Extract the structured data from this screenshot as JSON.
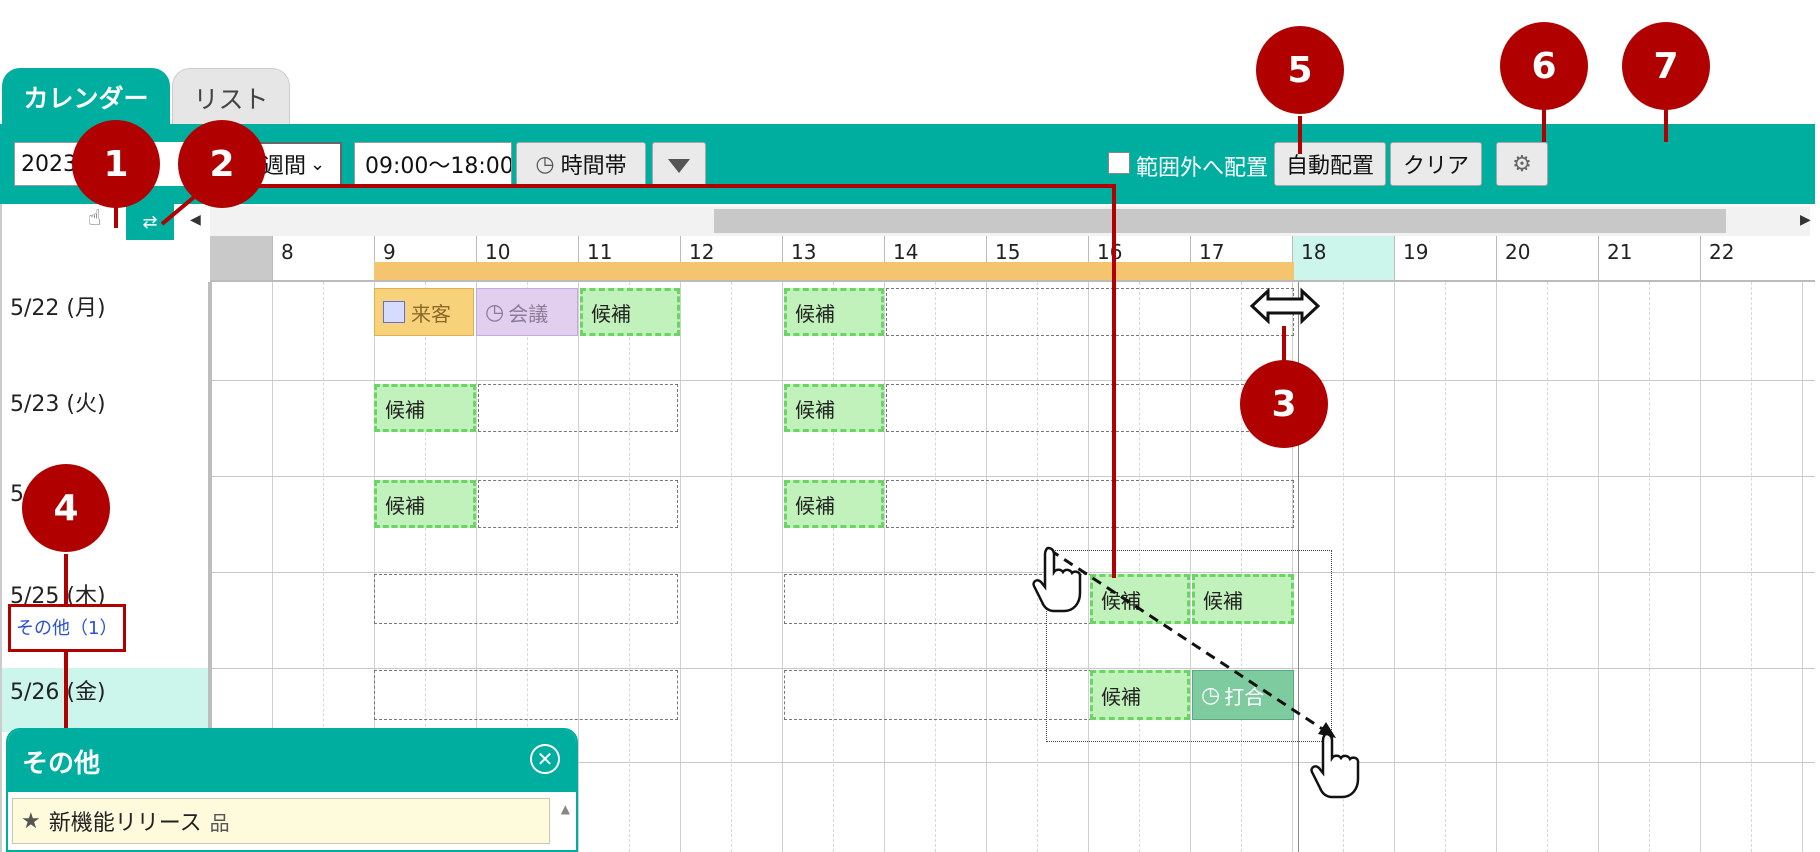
{
  "tabs": {
    "calendar": "カレンダー",
    "list": "リスト"
  },
  "toolbar": {
    "date_value": "2023",
    "period_value": "1週間",
    "time_range": "09:00～18:00",
    "timeband_label": "時間帯",
    "out_of_range_label": "範囲外へ配置",
    "auto_place_label": "自動配置",
    "clear_label": "クリア"
  },
  "hours": [
    "8",
    "9",
    "10",
    "11",
    "12",
    "13",
    "14",
    "15",
    "16",
    "17",
    "18",
    "19",
    "20",
    "21",
    "22"
  ],
  "rows": [
    {
      "label": "5/22 (月)"
    },
    {
      "label": "5/23 (火)"
    },
    {
      "label": "5/24 (水)",
      "visible_label": "5"
    },
    {
      "label": "5/25 (木)",
      "other_link": "その他（1）"
    },
    {
      "label": "5/26 (金)"
    }
  ],
  "events": {
    "raikyaku": "来客",
    "kaigi": "会議",
    "candidate": "候補",
    "uchiawase": "打合"
  },
  "markers": [
    "1",
    "2",
    "3",
    "4",
    "5",
    "6",
    "7"
  ],
  "popup": {
    "title": "その他",
    "item_label": "新機能リリース"
  },
  "colors": {
    "accent": "#00aea0",
    "marker": "#b00000",
    "candidate_fill": "#c2f2bb",
    "business_hours": "#f4c46e",
    "today": "#ccf5ec"
  }
}
